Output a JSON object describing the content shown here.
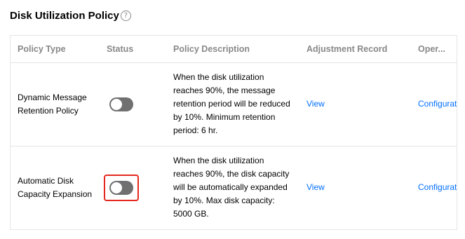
{
  "section": {
    "title": "Disk Utilization Policy",
    "help_glyph": "?"
  },
  "table": {
    "headers": {
      "policy_type": "Policy Type",
      "status": "Status",
      "policy_description": "Policy Description",
      "adjustment_record": "Adjustment Record",
      "operation": "Oper..."
    },
    "rows": [
      {
        "policy_type": "Dynamic Message Retention Policy",
        "status": "off",
        "description": "When the disk utilization reaches 90%, the message retention period will be reduced by 10%. Minimum retention period: 6 hr.",
        "record_link": "View",
        "operation_link": "Configuration"
      },
      {
        "policy_type": "Automatic Disk Capacity Expansion",
        "status": "off",
        "highlighted": true,
        "description": "When the disk utilization reaches 90%, the disk capacity will be automatically expanded by 10%. Max disk capacity: 5000 GB.",
        "record_link": "View",
        "operation_link": "Configuration"
      }
    ]
  },
  "colors": {
    "link": "#006eff",
    "toggle_off": "#707070",
    "highlight_border": "#e5281f",
    "header_text": "#888888",
    "border": "#e5e5e5"
  }
}
